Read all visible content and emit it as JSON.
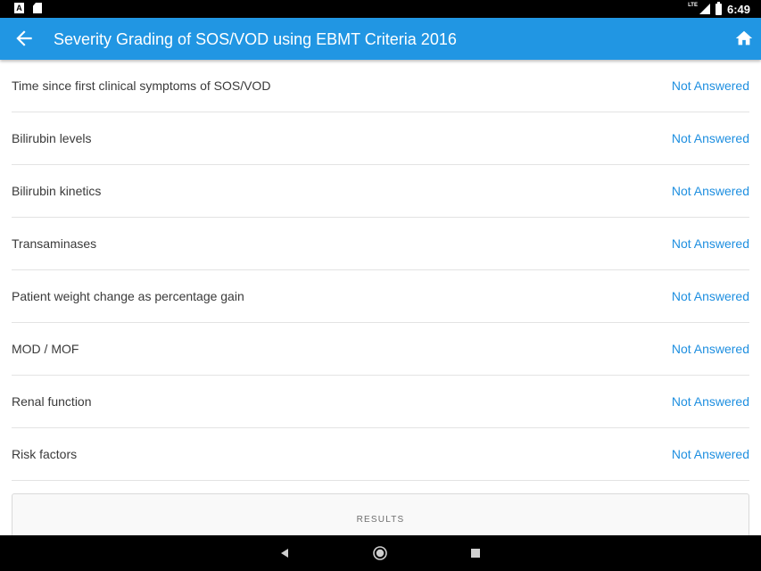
{
  "status_bar": {
    "network_label": "LTE",
    "time": "6:49",
    "notification_icons": [
      "a-icon",
      "sd-card-icon"
    ]
  },
  "app_bar": {
    "title": "Severity Grading of SOS/VOD using EBMT Criteria 2016",
    "back_icon": "arrow-left-icon",
    "home_icon": "home-icon",
    "background": "#2196e3"
  },
  "criteria": [
    {
      "label": "Time since first clinical symptoms of SOS/VOD",
      "status": "Not Answered"
    },
    {
      "label": "Bilirubin levels",
      "status": "Not Answered"
    },
    {
      "label": "Bilirubin kinetics",
      "status": "Not Answered"
    },
    {
      "label": "Transaminases",
      "status": "Not Answered"
    },
    {
      "label": "Patient weight change as percentage gain",
      "status": "Not Answered"
    },
    {
      "label": "MOD / MOF",
      "status": "Not Answered"
    },
    {
      "label": "Renal function",
      "status": "Not Answered"
    },
    {
      "label": "Risk factors",
      "status": "Not Answered"
    }
  ],
  "results": {
    "label": "RESULTS"
  },
  "colors": {
    "accent": "#1e8fe0",
    "status_text": "#1e8fe0"
  }
}
